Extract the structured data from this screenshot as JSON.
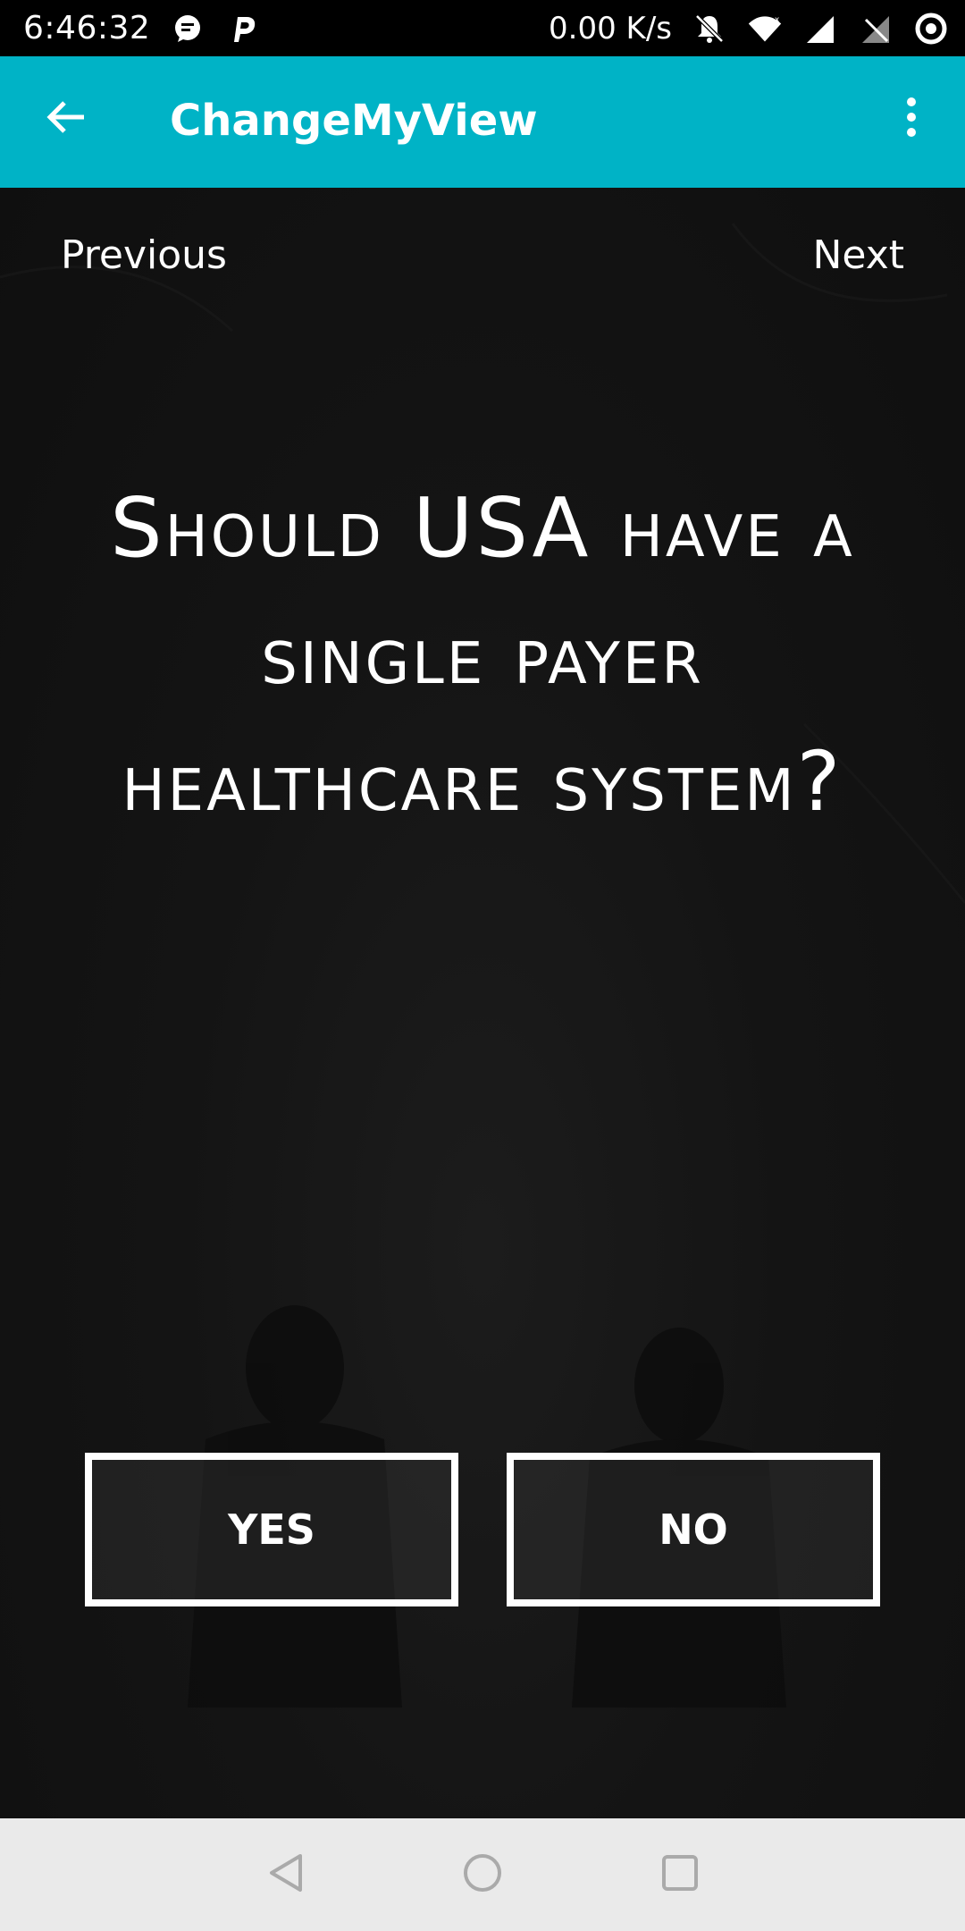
{
  "status_bar": {
    "time": "6:46:32",
    "net_speed": "0.00 K/s",
    "icons": [
      "chat-bubble-icon",
      "parking-p-icon",
      "mute-bell-icon",
      "wifi-icon",
      "cell-signal-icon",
      "no-sim-icon",
      "sync-circle-icon"
    ]
  },
  "app_bar": {
    "title": "ChangeMyView",
    "back_icon": "arrow-left-icon",
    "menu_icon": "more-vertical-icon",
    "color": "#00B3C6"
  },
  "navigation": {
    "previous_label": "Previous",
    "next_label": "Next"
  },
  "question": {
    "text": "Should USA have a single payer healthcare system?"
  },
  "answers": {
    "yes_label": "YES",
    "no_label": "NO"
  },
  "system_nav": {
    "icons": [
      "triangle-back-icon",
      "circle-home-icon",
      "square-recents-icon"
    ]
  }
}
